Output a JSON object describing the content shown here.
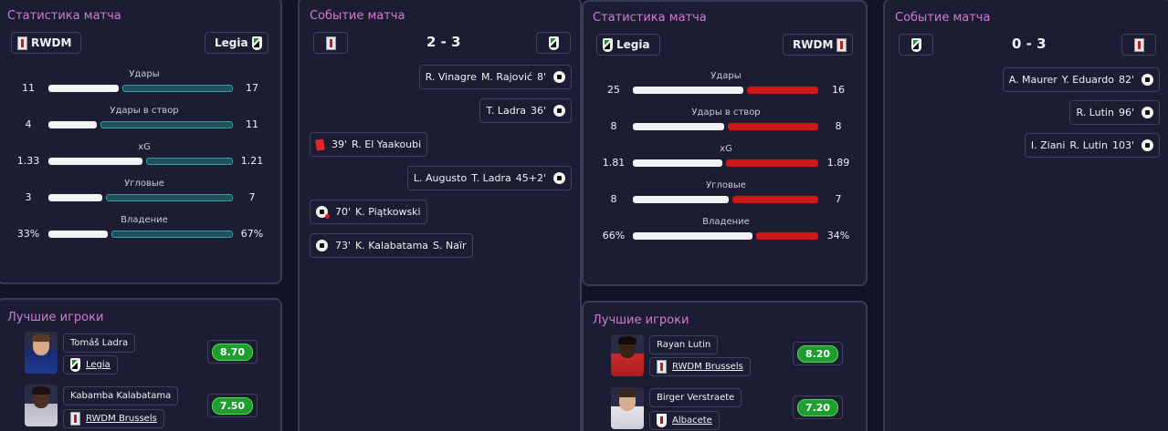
{
  "labels": {
    "stats_title": "Статистика матча",
    "events_title": "Событие матча",
    "players_title": "Лучшие игроки"
  },
  "colors": {
    "title_accent": "#cf7bd3",
    "home_bar": "#f3f3f6",
    "teal_bar": "#3e9aa4",
    "red_bar": "#d11619",
    "rating_green": "#1e9e2e"
  },
  "match1": {
    "home_team": "RWDM",
    "away_team": "Legia",
    "score": "2 - 3",
    "stats": [
      {
        "label": "Удары",
        "home": "11",
        "away": "17",
        "home_frac": 0.39
      },
      {
        "label": "Удары в створ",
        "home": "4",
        "away": "11",
        "home_frac": 0.27
      },
      {
        "label": "xG",
        "home": "1.33",
        "away": "1.21",
        "home_frac": 0.52
      },
      {
        "label": "Угловые",
        "home": "3",
        "away": "7",
        "home_frac": 0.3
      },
      {
        "label": "Владение",
        "home": "33%",
        "away": "67%",
        "home_frac": 0.33
      }
    ],
    "events": [
      {
        "side": "away",
        "parts": [
          "R. Vinagre",
          "M. Rajović",
          "8'"
        ],
        "icon": "ball-icon"
      },
      {
        "side": "away",
        "parts": [
          "T. Ladra",
          "36'"
        ],
        "icon": "ball-icon"
      },
      {
        "side": "home",
        "parts": [
          "39'",
          "R. El Yaakoubi"
        ],
        "icon": "red-card-icon"
      },
      {
        "side": "away",
        "parts": [
          "L. Augusto",
          "T. Ladra",
          "45+2'"
        ],
        "icon": "ball-icon"
      },
      {
        "side": "home",
        "parts": [
          "70'",
          "K. Piątkowski"
        ],
        "icon": "missed-penalty-icon"
      },
      {
        "side": "home",
        "parts": [
          "73'",
          "K. Kalabatama",
          "S. Naïr"
        ],
        "icon": "ball-icon"
      }
    ],
    "players": [
      {
        "name": "Tomáš Ladra",
        "team": "Legia",
        "rating": "8.70"
      },
      {
        "name": "Kabamba Kalabatama",
        "team": "RWDM Brussels",
        "rating": "7.50"
      }
    ]
  },
  "match2": {
    "home_team": "Legia",
    "away_team": "RWDM",
    "score": "0 - 3",
    "stats": [
      {
        "label": "Удары",
        "home": "25",
        "away": "16",
        "home_frac": 0.61
      },
      {
        "label": "Удары в створ",
        "home": "8",
        "away": "8",
        "home_frac": 0.5
      },
      {
        "label": "xG",
        "home": "1.81",
        "away": "1.89",
        "home_frac": 0.49
      },
      {
        "label": "Угловые",
        "home": "8",
        "away": "7",
        "home_frac": 0.53
      },
      {
        "label": "Владение",
        "home": "66%",
        "away": "34%",
        "home_frac": 0.66
      }
    ],
    "events": [
      {
        "side": "away",
        "parts": [
          "A. Maurer",
          "Y. Eduardo",
          "82'"
        ],
        "icon": "ball-icon"
      },
      {
        "side": "away",
        "parts": [
          "R. Lutin",
          "96'"
        ],
        "icon": "ball-icon"
      },
      {
        "side": "away",
        "parts": [
          "I. Ziani",
          "R. Lutin",
          "103'"
        ],
        "icon": "ball-icon"
      }
    ],
    "players": [
      {
        "name": "Rayan Lutin",
        "team": "RWDM Brussels",
        "rating": "8.20"
      },
      {
        "name": "Birger Verstraete",
        "team": "Albacete",
        "rating": "7.20"
      }
    ]
  }
}
